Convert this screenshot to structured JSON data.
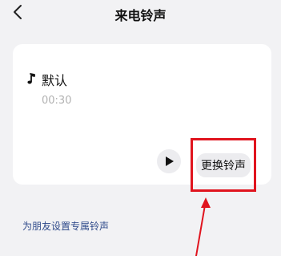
{
  "header": {
    "title": "来电铃声"
  },
  "ringtone": {
    "name": "默认",
    "duration": "00:30"
  },
  "actions": {
    "change_label": "更换铃声"
  },
  "links": {
    "friend_ringtone": "为朋友设置专属铃声"
  },
  "annotation": {
    "highlight_color": "#e0141e"
  }
}
